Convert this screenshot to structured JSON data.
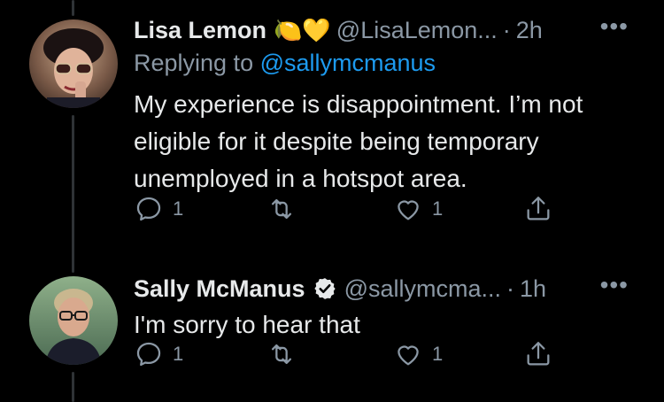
{
  "tweets": [
    {
      "name": "Lisa Lemon",
      "emoji": "🍋💛",
      "handle": "@LisaLemon...",
      "time": "2h",
      "more": "•••",
      "replying_prefix": "Replying to",
      "replying_to": "@sallymcmanus",
      "text": "My experience is disappointment. I’m not eligible for it despite being temporary unemployed in a hotspot area.",
      "replies": "1",
      "likes": "1"
    },
    {
      "name": "Sally McManus",
      "verified": true,
      "handle": "@sallymcma...",
      "time": "1h",
      "more": "•••",
      "text": "I'm sorry to hear that",
      "replies": "1",
      "likes": "1"
    }
  ],
  "separator": "·",
  "colors": {
    "background": "#000000",
    "text": "#e7e9ea",
    "muted": "#8b98a5",
    "link": "#1d9bf0",
    "thread_line": "#2f3336"
  },
  "icons": [
    "reply-icon",
    "retweet-icon",
    "like-icon",
    "share-icon",
    "verified-icon"
  ]
}
